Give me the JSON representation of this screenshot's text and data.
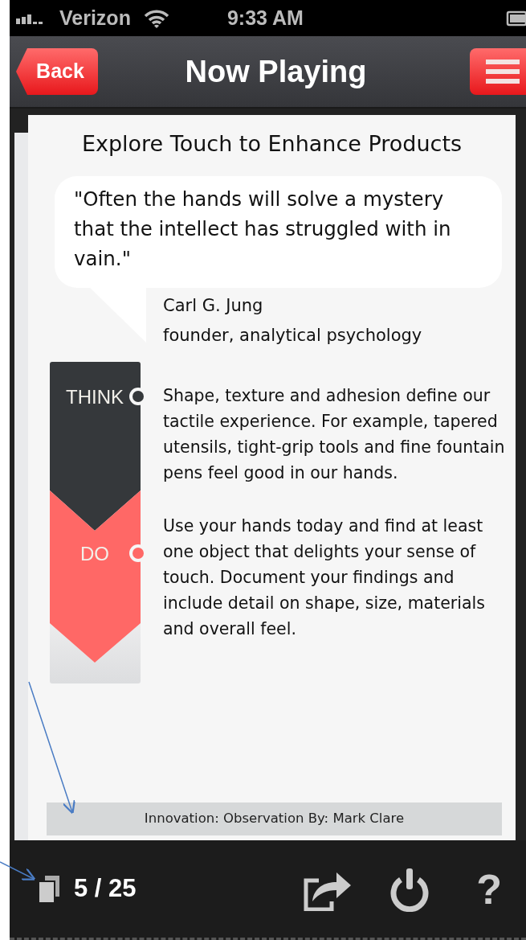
{
  "status_bar": {
    "carrier": "Verizon",
    "time": "9:33 AM"
  },
  "nav_bar": {
    "back": "Back",
    "title": "Now Playing"
  },
  "card": {
    "title": "Explore Touch to Enhance Products",
    "quote": "\"Often the hands will solve a mystery that the intellect has struggled with in vain.\"",
    "author": "Carl G. Jung",
    "author_role": "founder, analytical psychology",
    "stages": [
      {
        "label": "THINK",
        "color": "#35383b",
        "text": "Shape, texture and adhesion define our tactile experience. For example, tapered utensils, tight-grip tools and fine fountain pens feel good in our hands."
      },
      {
        "label": "DO",
        "color": "#ff6866",
        "text": "Use your hands today and find at least one object that delights your sense of touch.  Document your findings and include detail on shape, size, materials and overall feel."
      }
    ],
    "credit": "Innovation: Observation By: Mark Clare"
  },
  "footer": {
    "page": "5 / 25",
    "help": "?"
  }
}
